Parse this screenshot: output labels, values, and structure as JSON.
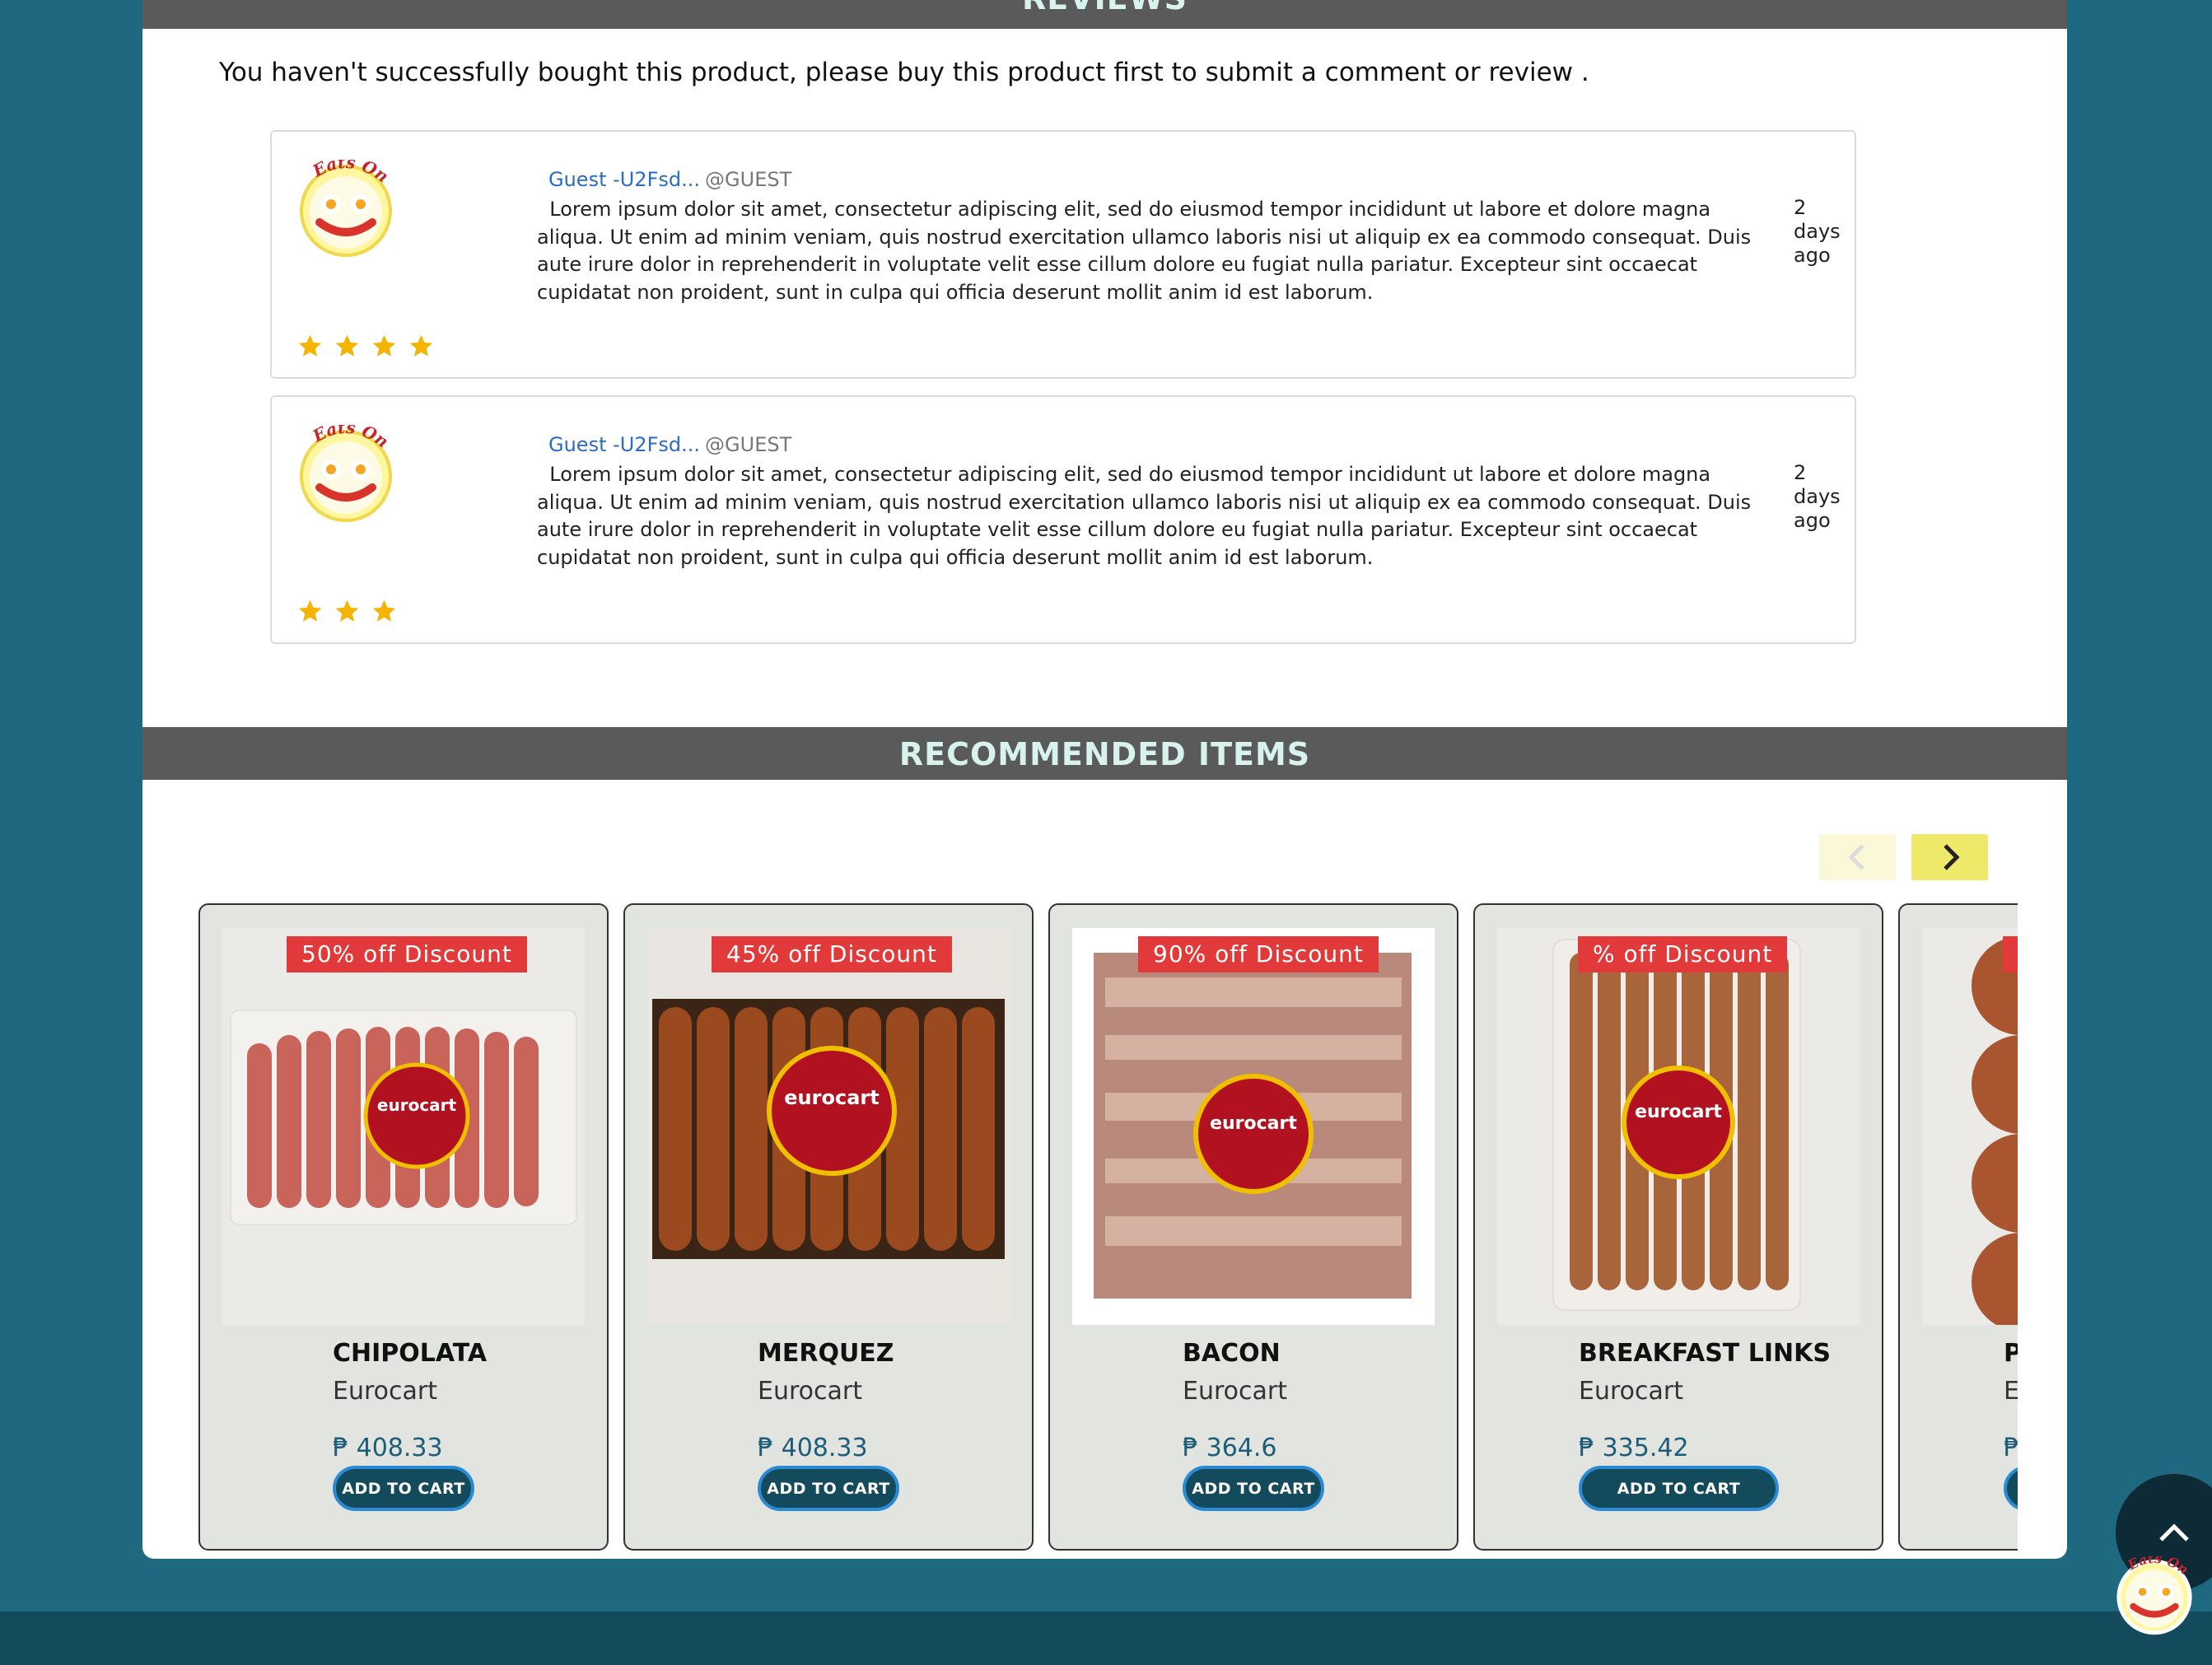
{
  "reviews": {
    "section_title": "REVIEWS",
    "notice": "You haven't successfully bought this product, please buy this product first to submit a comment or review .",
    "items": [
      {
        "user": "Guest -U2Fsd...",
        "handle": "@GUEST",
        "body": "Lorem ipsum dolor sit amet, consectetur adipiscing elit, sed do eiusmod tempor incididunt ut labore et dolore magna aliqua. Ut enim ad minim veniam, quis nostrud exercitation ullamco laboris nisi ut aliquip ex ea commodo consequat. Duis aute irure dolor in reprehenderit in voluptate velit esse cillum dolore eu fugiat nulla pariatur. Excepteur sint occaecat cupidatat non proident, sunt in culpa qui officia deserunt mollit anim id est laborum.",
        "time": "2 days ago",
        "rating": 4,
        "avatar_text": "Eats Online"
      },
      {
        "user": "Guest -U2Fsd...",
        "handle": "@GUEST",
        "body": "Lorem ipsum dolor sit amet, consectetur adipiscing elit, sed do eiusmod tempor incididunt ut labore et dolore magna aliqua. Ut enim ad minim veniam, quis nostrud exercitation ullamco laboris nisi ut aliquip ex ea commodo consequat. Duis aute irure dolor in reprehenderit in voluptate velit esse cillum dolore eu fugiat nulla pariatur. Excepteur sint occaecat cupidatat non proident, sunt in culpa qui officia deserunt mollit anim id est laborum.",
        "time": "2 days ago",
        "rating": 3,
        "avatar_text": "Eats Online"
      }
    ]
  },
  "recommended": {
    "section_title": "RECOMMENDED ITEMS",
    "prev_icon": "chevron-left-icon",
    "next_icon": "chevron-right-icon",
    "items": [
      {
        "discount": "50% off Discount",
        "name": "CHIPOLATA",
        "brand": "Eurocart",
        "price": "₱ 408.33",
        "button": "ADD TO CART",
        "label_brand": "eurocart"
      },
      {
        "discount": "45% off Discount",
        "name": "MERQUEZ",
        "brand": "Eurocart",
        "price": "₱ 408.33",
        "button": "ADD TO CART",
        "label_brand": "eurocart"
      },
      {
        "discount": "90% off Discount",
        "name": "BACON",
        "brand": "Eurocart",
        "price": "₱ 364.6",
        "button": "ADD TO CART",
        "label_brand": "eurocart"
      },
      {
        "discount": "% off Discount",
        "name": "BREAKFAST LINKS",
        "brand": "Eurocart",
        "price": "₱ 335.42",
        "button": "ADD TO CART",
        "label_brand": "eurocart"
      },
      {
        "discount": "",
        "name": "P",
        "brand": "E",
        "price": "₱",
        "button": "",
        "label_brand": ""
      }
    ]
  },
  "widgets": {
    "scroll_top_icon": "chevron-up-icon",
    "chat_logo_text": "Eats Online"
  },
  "colors": {
    "page_bg": "#1e6880",
    "section_bar": "#5a5a5a",
    "section_title": "#d8f3ee",
    "discount_badge": "#e23a3a",
    "star": "#f5b400",
    "button_bg": "#144b5c",
    "price": "#1d5d7a"
  }
}
